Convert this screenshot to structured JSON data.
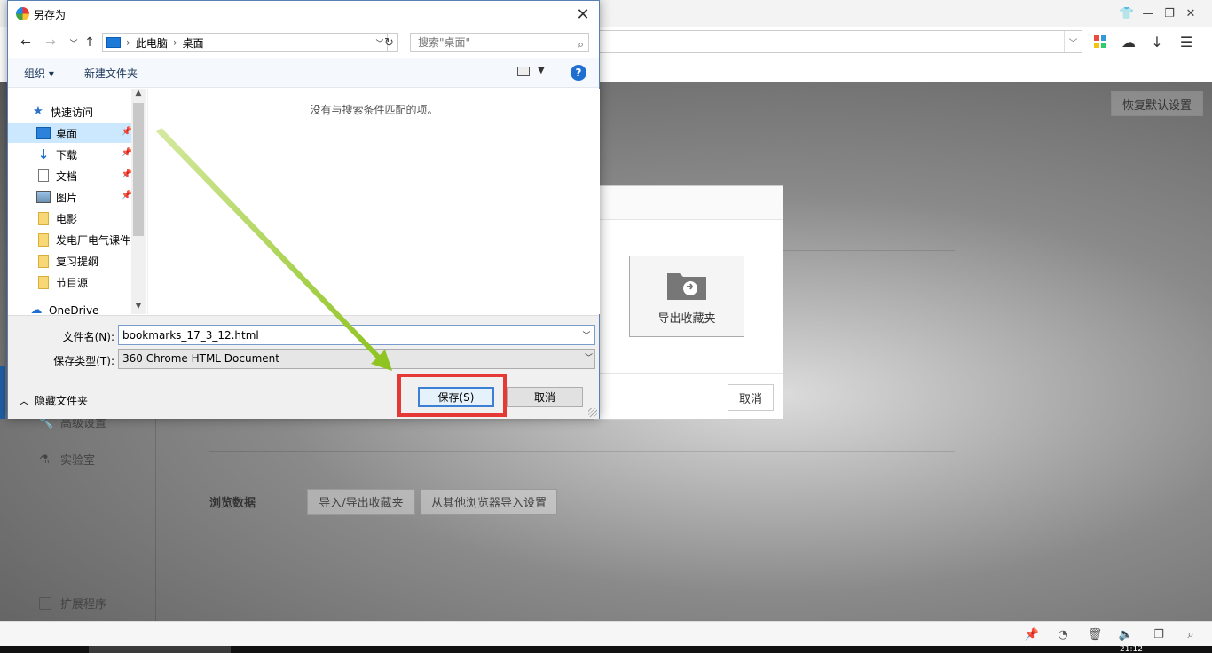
{
  "browser": {
    "restore_default": "恢复默认设置",
    "sidebar": {
      "advanced": "高级设置",
      "lab": "实验室",
      "extensions": "扩展程序"
    },
    "browse_data_label": "浏览数据",
    "import_export_button": "导入/导出收藏夹",
    "import_other_button": "从其他浏览器导入设置",
    "clock": "21:12"
  },
  "export_dialog": {
    "tile_label": "导出收藏夹",
    "cancel": "取消"
  },
  "saveas": {
    "title": "另存为",
    "path": [
      "此电脑",
      "桌面"
    ],
    "search_placeholder": "搜索\"桌面\"",
    "organize": "组织 ▾",
    "new_folder": "新建文件夹",
    "help": "?",
    "nav_tree": {
      "quick_access": "快速访问",
      "desktop": "桌面",
      "downloads": "下载",
      "documents": "文档",
      "pictures": "图片",
      "movies": "电影",
      "folder_1": "发电厂电气课件",
      "folder_2": "复习提纲",
      "folder_3": "节目源",
      "onedrive": "OneDrive"
    },
    "empty_message": "没有与搜索条件匹配的项。",
    "filename_label": "文件名(N):",
    "filename_value": "bookmarks_17_3_12.html",
    "filetype_label": "保存类型(T):",
    "filetype_value": "360 Chrome HTML Document",
    "hide_folders": "隐藏文件夹",
    "save": "保存(S)",
    "cancel": "取消"
  },
  "colors": {
    "highlight": "#e53935",
    "arrow": "#8cc21c",
    "accent": "#1f6fd1"
  }
}
